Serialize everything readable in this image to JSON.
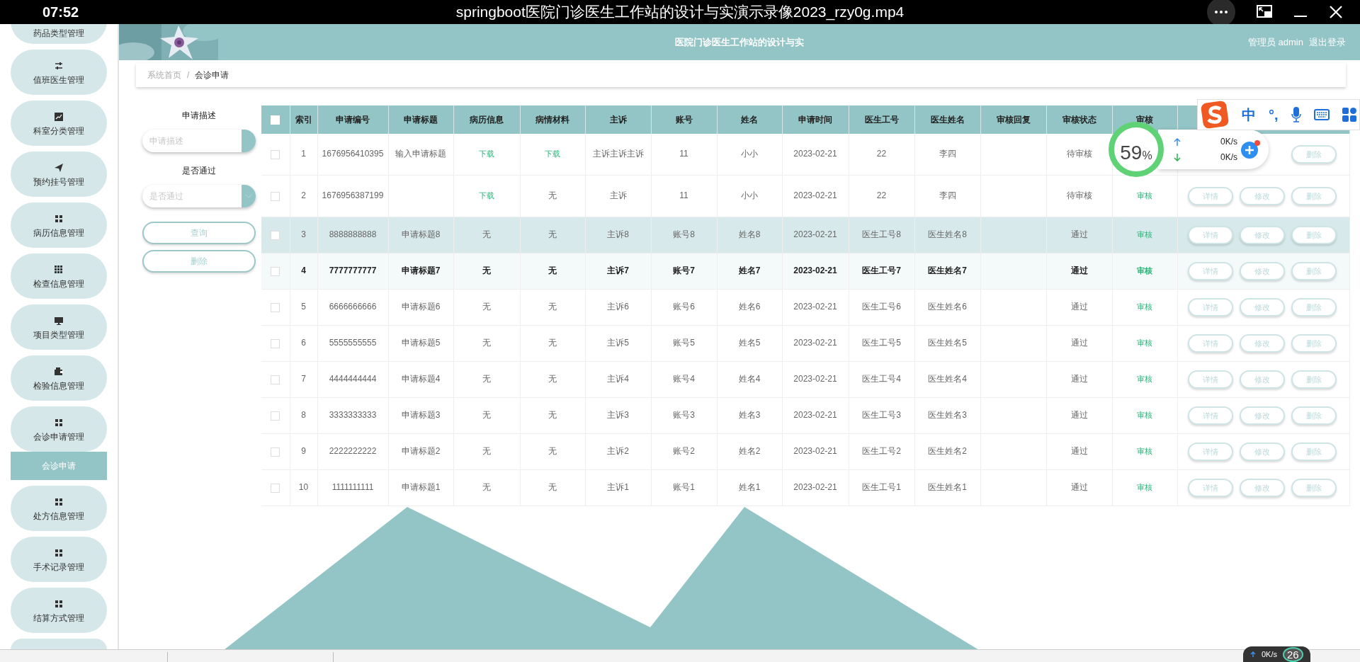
{
  "player": {
    "time": "07:52",
    "title": "springboot医院门诊医生工作站的设计与实演示录像2023_rzy0g.mp4"
  },
  "header": {
    "title": "医院门诊医生工作站的设计与实",
    "user": "管理员 admin",
    "logout": "退出登录"
  },
  "sidebar": {
    "items": [
      {
        "label": "药品类型管理",
        "expanded": false
      },
      {
        "label": "值班医生管理",
        "expanded": false
      },
      {
        "label": "科室分类管理",
        "expanded": false
      },
      {
        "label": "预约挂号管理",
        "expanded": false
      },
      {
        "label": "病历信息管理",
        "expanded": false
      },
      {
        "label": "检查信息管理",
        "expanded": false
      },
      {
        "label": "项目类型管理",
        "expanded": false
      },
      {
        "label": "检验信息管理",
        "expanded": false
      },
      {
        "label": "会诊申请管理",
        "expanded": true,
        "children": [
          {
            "label": "会诊申请",
            "selected": true
          }
        ]
      },
      {
        "label": "处方信息管理",
        "expanded": false
      },
      {
        "label": "手术记录管理",
        "expanded": false
      },
      {
        "label": "结算方式管理",
        "expanded": false
      }
    ]
  },
  "breadcrumb": [
    "系统首页",
    "/",
    "会诊申请"
  ],
  "search": {
    "fields": [
      {
        "kind": "input",
        "label": "申请描述",
        "placeholder": "申请描述"
      },
      {
        "kind": "select",
        "label": "是否通过",
        "placeholder": "是否通过"
      }
    ],
    "buttons": [
      "查询",
      "删除"
    ]
  },
  "table": {
    "header_checked": false,
    "columns": [
      "索引",
      "申请编号",
      "申请标题",
      "病历信息",
      "病情材料",
      "主诉",
      "账号",
      "姓名",
      "申请时间",
      "医生工号",
      "医生姓名",
      "审核回复",
      "审核状态",
      "审核"
    ],
    "rows": [
      {
        "checked": false,
        "highlighted": false,
        "hovered": false,
        "cells": [
          {
            "kind": "text",
            "text": "1"
          },
          {
            "kind": "text",
            "text": "1676956410395"
          },
          {
            "kind": "text",
            "text": "输入申请标题"
          },
          {
            "kind": "link",
            "text": "下载"
          },
          {
            "kind": "link",
            "text": "下载"
          },
          {
            "kind": "text",
            "text": "主诉主诉主诉"
          },
          {
            "kind": "text",
            "text": "11"
          },
          {
            "kind": "text",
            "text": "小小"
          },
          {
            "kind": "text",
            "text": "2023-02-21"
          },
          {
            "kind": "text",
            "text": "22"
          },
          {
            "kind": "text",
            "text": "李四"
          },
          {
            "kind": "blank"
          },
          {
            "kind": "text",
            "text": "待审核"
          },
          {
            "kind": "blank"
          }
        ],
        "actions": [
          "删除"
        ]
      },
      {
        "checked": false,
        "highlighted": false,
        "hovered": false,
        "cells": [
          {
            "kind": "text",
            "text": "2"
          },
          {
            "kind": "text",
            "text": "1676956387199"
          },
          {
            "kind": "blank"
          },
          {
            "kind": "link",
            "text": "下载"
          },
          {
            "kind": "text",
            "text": "无"
          },
          {
            "kind": "text",
            "text": "主诉"
          },
          {
            "kind": "text",
            "text": "11"
          },
          {
            "kind": "text",
            "text": "小小"
          },
          {
            "kind": "text",
            "text": "2023-02-21"
          },
          {
            "kind": "text",
            "text": "22"
          },
          {
            "kind": "text",
            "text": "李四"
          },
          {
            "kind": "blank"
          },
          {
            "kind": "text",
            "text": "待审核"
          },
          {
            "kind": "link",
            "text": "审核"
          }
        ],
        "actions": [
          "详情",
          "修改",
          "删除"
        ]
      },
      {
        "checked": false,
        "highlighted": true,
        "hovered": false,
        "cells": [
          {
            "kind": "text",
            "text": "3"
          },
          {
            "kind": "text",
            "text": "8888888888"
          },
          {
            "kind": "text",
            "text": "申请标题8"
          },
          {
            "kind": "text",
            "text": "无"
          },
          {
            "kind": "text",
            "text": "无"
          },
          {
            "kind": "text",
            "text": "主诉8"
          },
          {
            "kind": "text",
            "text": "账号8"
          },
          {
            "kind": "text",
            "text": "姓名8"
          },
          {
            "kind": "text",
            "text": "2023-02-21"
          },
          {
            "kind": "text",
            "text": "医生工号8"
          },
          {
            "kind": "text",
            "text": "医生姓名8"
          },
          {
            "kind": "blank"
          },
          {
            "kind": "text",
            "text": "通过"
          },
          {
            "kind": "link",
            "text": "审核"
          }
        ],
        "actions": [
          "详情",
          "修改",
          "删除"
        ]
      },
      {
        "checked": false,
        "highlighted": false,
        "hovered": true,
        "cells": [
          {
            "kind": "text",
            "text": "4"
          },
          {
            "kind": "text",
            "text": "7777777777"
          },
          {
            "kind": "text",
            "text": "申请标题7"
          },
          {
            "kind": "text",
            "text": "无"
          },
          {
            "kind": "text",
            "text": "无"
          },
          {
            "kind": "text",
            "text": "主诉7"
          },
          {
            "kind": "text",
            "text": "账号7"
          },
          {
            "kind": "text",
            "text": "姓名7"
          },
          {
            "kind": "text",
            "text": "2023-02-21"
          },
          {
            "kind": "text",
            "text": "医生工号7"
          },
          {
            "kind": "text",
            "text": "医生姓名7"
          },
          {
            "kind": "blank"
          },
          {
            "kind": "text",
            "text": "通过"
          },
          {
            "kind": "link",
            "text": "审核"
          }
        ],
        "actions": [
          "详情",
          "修改",
          "删除"
        ]
      },
      {
        "checked": false,
        "highlighted": false,
        "hovered": false,
        "cells": [
          {
            "kind": "text",
            "text": "5"
          },
          {
            "kind": "text",
            "text": "6666666666"
          },
          {
            "kind": "text",
            "text": "申请标题6"
          },
          {
            "kind": "text",
            "text": "无"
          },
          {
            "kind": "text",
            "text": "无"
          },
          {
            "kind": "text",
            "text": "主诉6"
          },
          {
            "kind": "text",
            "text": "账号6"
          },
          {
            "kind": "text",
            "text": "姓名6"
          },
          {
            "kind": "text",
            "text": "2023-02-21"
          },
          {
            "kind": "text",
            "text": "医生工号6"
          },
          {
            "kind": "text",
            "text": "医生姓名6"
          },
          {
            "kind": "blank"
          },
          {
            "kind": "text",
            "text": "通过"
          },
          {
            "kind": "link",
            "text": "审核"
          }
        ],
        "actions": [
          "详情",
          "修改",
          "删除"
        ]
      },
      {
        "checked": false,
        "highlighted": false,
        "hovered": false,
        "cells": [
          {
            "kind": "text",
            "text": "6"
          },
          {
            "kind": "text",
            "text": "5555555555"
          },
          {
            "kind": "text",
            "text": "申请标题5"
          },
          {
            "kind": "text",
            "text": "无"
          },
          {
            "kind": "text",
            "text": "无"
          },
          {
            "kind": "text",
            "text": "主诉5"
          },
          {
            "kind": "text",
            "text": "账号5"
          },
          {
            "kind": "text",
            "text": "姓名5"
          },
          {
            "kind": "text",
            "text": "2023-02-21"
          },
          {
            "kind": "text",
            "text": "医生工号5"
          },
          {
            "kind": "text",
            "text": "医生姓名5"
          },
          {
            "kind": "blank"
          },
          {
            "kind": "text",
            "text": "通过"
          },
          {
            "kind": "link",
            "text": "审核"
          }
        ],
        "actions": [
          "详情",
          "修改",
          "删除"
        ]
      },
      {
        "checked": false,
        "highlighted": false,
        "hovered": false,
        "cells": [
          {
            "kind": "text",
            "text": "7"
          },
          {
            "kind": "text",
            "text": "4444444444"
          },
          {
            "kind": "text",
            "text": "申请标题4"
          },
          {
            "kind": "text",
            "text": "无"
          },
          {
            "kind": "text",
            "text": "无"
          },
          {
            "kind": "text",
            "text": "主诉4"
          },
          {
            "kind": "text",
            "text": "账号4"
          },
          {
            "kind": "text",
            "text": "姓名4"
          },
          {
            "kind": "text",
            "text": "2023-02-21"
          },
          {
            "kind": "text",
            "text": "医生工号4"
          },
          {
            "kind": "text",
            "text": "医生姓名4"
          },
          {
            "kind": "blank"
          },
          {
            "kind": "text",
            "text": "通过"
          },
          {
            "kind": "link",
            "text": "审核"
          }
        ],
        "actions": [
          "详情",
          "修改",
          "删除"
        ]
      },
      {
        "checked": false,
        "highlighted": false,
        "hovered": false,
        "cells": [
          {
            "kind": "text",
            "text": "8"
          },
          {
            "kind": "text",
            "text": "3333333333"
          },
          {
            "kind": "text",
            "text": "申请标题3"
          },
          {
            "kind": "text",
            "text": "无"
          },
          {
            "kind": "text",
            "text": "无"
          },
          {
            "kind": "text",
            "text": "主诉3"
          },
          {
            "kind": "text",
            "text": "账号3"
          },
          {
            "kind": "text",
            "text": "姓名3"
          },
          {
            "kind": "text",
            "text": "2023-02-21"
          },
          {
            "kind": "text",
            "text": "医生工号3"
          },
          {
            "kind": "text",
            "text": "医生姓名3"
          },
          {
            "kind": "blank"
          },
          {
            "kind": "text",
            "text": "通过"
          },
          {
            "kind": "link",
            "text": "审核"
          }
        ],
        "actions": [
          "详情",
          "修改",
          "删除"
        ]
      },
      {
        "checked": false,
        "highlighted": false,
        "hovered": false,
        "cells": [
          {
            "kind": "text",
            "text": "9"
          },
          {
            "kind": "text",
            "text": "2222222222"
          },
          {
            "kind": "text",
            "text": "申请标题2"
          },
          {
            "kind": "text",
            "text": "无"
          },
          {
            "kind": "text",
            "text": "无"
          },
          {
            "kind": "text",
            "text": "主诉2"
          },
          {
            "kind": "text",
            "text": "账号2"
          },
          {
            "kind": "text",
            "text": "姓名2"
          },
          {
            "kind": "text",
            "text": "2023-02-21"
          },
          {
            "kind": "text",
            "text": "医生工号2"
          },
          {
            "kind": "text",
            "text": "医生姓名2"
          },
          {
            "kind": "blank"
          },
          {
            "kind": "text",
            "text": "通过"
          },
          {
            "kind": "link",
            "text": "审核"
          }
        ],
        "actions": [
          "详情",
          "修改",
          "删除"
        ]
      },
      {
        "checked": false,
        "highlighted": false,
        "hovered": false,
        "cells": [
          {
            "kind": "text",
            "text": "10"
          },
          {
            "kind": "text",
            "text": "1111111111"
          },
          {
            "kind": "text",
            "text": "申请标题1"
          },
          {
            "kind": "text",
            "text": "无"
          },
          {
            "kind": "text",
            "text": "无"
          },
          {
            "kind": "text",
            "text": "主诉1"
          },
          {
            "kind": "text",
            "text": "账号1"
          },
          {
            "kind": "text",
            "text": "姓名1"
          },
          {
            "kind": "text",
            "text": "2023-02-21"
          },
          {
            "kind": "text",
            "text": "医生工号1"
          },
          {
            "kind": "text",
            "text": "医生姓名1"
          },
          {
            "kind": "blank"
          },
          {
            "kind": "text",
            "text": "通过"
          },
          {
            "kind": "link",
            "text": "审核"
          }
        ],
        "actions": [
          "详情",
          "修改",
          "删除"
        ]
      }
    ]
  },
  "speed_widget": {
    "percent": "59",
    "unit": "%",
    "up": "0K/s",
    "down": "0K/s"
  },
  "ime_toolbar": {
    "language": "中",
    "punctuation": "°,"
  },
  "mini_speed": {
    "up": "0K/s",
    "value": "26"
  }
}
